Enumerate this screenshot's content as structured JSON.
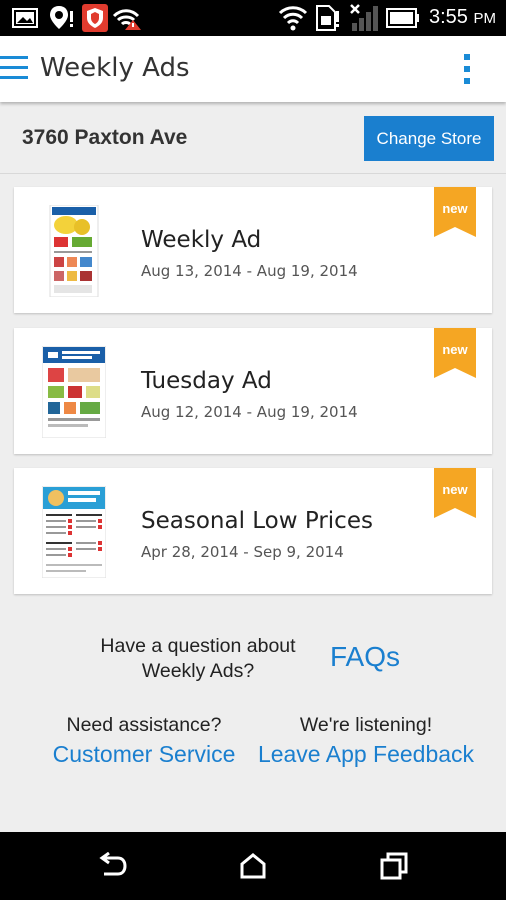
{
  "status_bar": {
    "time": "3:55",
    "ampm": "PM",
    "icons": [
      "gallery-icon",
      "location-alert-icon",
      "shield-app-icon",
      "wifi-alert-icon",
      "wifi-icon",
      "sim-icon",
      "signal-no-service-icon",
      "battery-icon"
    ]
  },
  "app_bar": {
    "title": "Weekly Ads",
    "menu_icon": "hamburger-menu-icon",
    "overflow_icon": "more-vertical-icon",
    "accent_color": "#1a8bd6"
  },
  "store": {
    "address": "3760 Paxton Ave",
    "change_label": "Change Store"
  },
  "ads": [
    {
      "title": "Weekly Ad",
      "dates": "Aug 13, 2014 - Aug 19, 2014",
      "badge": "new"
    },
    {
      "title": "Tuesday Ad",
      "dates": "Aug 12, 2014 - Aug 19, 2014",
      "badge": "new"
    },
    {
      "title": "Seasonal Low Prices",
      "dates": "Apr 28, 2014 - Sep 9, 2014",
      "badge": "new"
    }
  ],
  "badge_color": "#f5a623",
  "help": {
    "question": "Have a question about Weekly Ads?",
    "faqs_label": "FAQs",
    "assistance_label": "Need assistance?",
    "customer_service_label": "Customer Service",
    "listening_label": "We're listening!",
    "feedback_label": "Leave App Feedback"
  },
  "nav_bar": {
    "icons": [
      "back-icon",
      "home-icon",
      "recents-icon"
    ]
  }
}
